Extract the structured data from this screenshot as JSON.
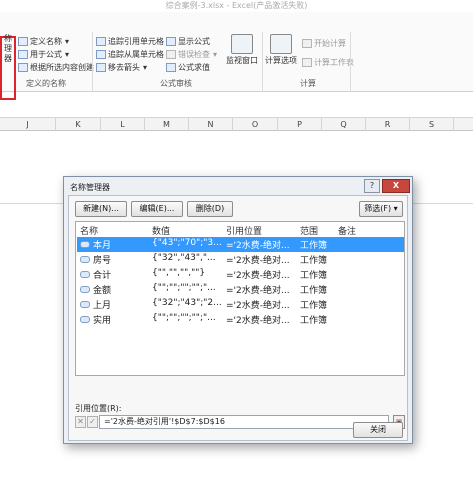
{
  "window": {
    "title": "综合案例-3.xlsx - Excel(产品激活失败)"
  },
  "ribbon": {
    "define_group": {
      "big_button_label_1": "称",
      "big_button_label_2": "理器",
      "define_name": "定义名称",
      "use_in_formula": "用于公式",
      "create_from_selection": "根据所选内容创建",
      "label": "定义的名称"
    },
    "audit_group": {
      "trace_precedents": "追踪引用单元格",
      "trace_dependents": "追踪从属单元格",
      "remove_arrows": "移去箭头",
      "show_formulas": "显示公式",
      "error_checking": "错误检查",
      "evaluate_formula": "公式求值",
      "watch_window": "监视窗口",
      "label": "公式审核"
    },
    "calc_group": {
      "calc_options": "计算选项",
      "calc_now": "开始计算",
      "calc_sheet": "计算工作表",
      "label": "计算"
    }
  },
  "grid": {
    "columns": [
      "J",
      "K",
      "L",
      "M",
      "N",
      "O",
      "P",
      "Q",
      "R",
      "S"
    ]
  },
  "dialog": {
    "title": "名称管理器",
    "help_label": "?",
    "close_x": "X",
    "new_button": "新建(N)...",
    "edit_button": "编辑(E)...",
    "delete_button": "删除(D)",
    "filter_button": "筛选(F) ▾",
    "headers": {
      "name": "名称",
      "value": "数值",
      "ref": "引用位置",
      "scope": "范围",
      "comment": "备注"
    },
    "rows": [
      {
        "name": "本月",
        "value": "{\"43\";\"70\";\"3...",
        "ref": "='2水费-绝对...",
        "scope": "工作簿",
        "selected": true
      },
      {
        "name": "房号",
        "value": "{\"32\",\"43\",\"...",
        "ref": "='2水费-绝对...",
        "scope": "工作簿",
        "selected": false
      },
      {
        "name": "合计",
        "value": "{\"\",\"\",\"\",\"\"}",
        "ref": "='2水费-绝对...",
        "scope": "工作簿",
        "selected": false
      },
      {
        "name": "金额",
        "value": "{\"\";\"\";\"\";\"\";\"...",
        "ref": "='2水费-绝对...",
        "scope": "工作簿",
        "selected": false
      },
      {
        "name": "上月",
        "value": "{\"32\";\"43\";\"2...",
        "ref": "='2水费-绝对...",
        "scope": "工作簿",
        "selected": false
      },
      {
        "name": "实用",
        "value": "{\"\";\"\";\"\";\"\";\"...",
        "ref": "='2水费-绝对...",
        "scope": "工作簿",
        "selected": false
      }
    ],
    "ref_label": "引用位置(R):",
    "ref_value": "='2水费-绝对引用'!$D$7:$D$16",
    "cancel_glyph": "✕",
    "confirm_glyph": "✓",
    "close_button": "关闭"
  }
}
